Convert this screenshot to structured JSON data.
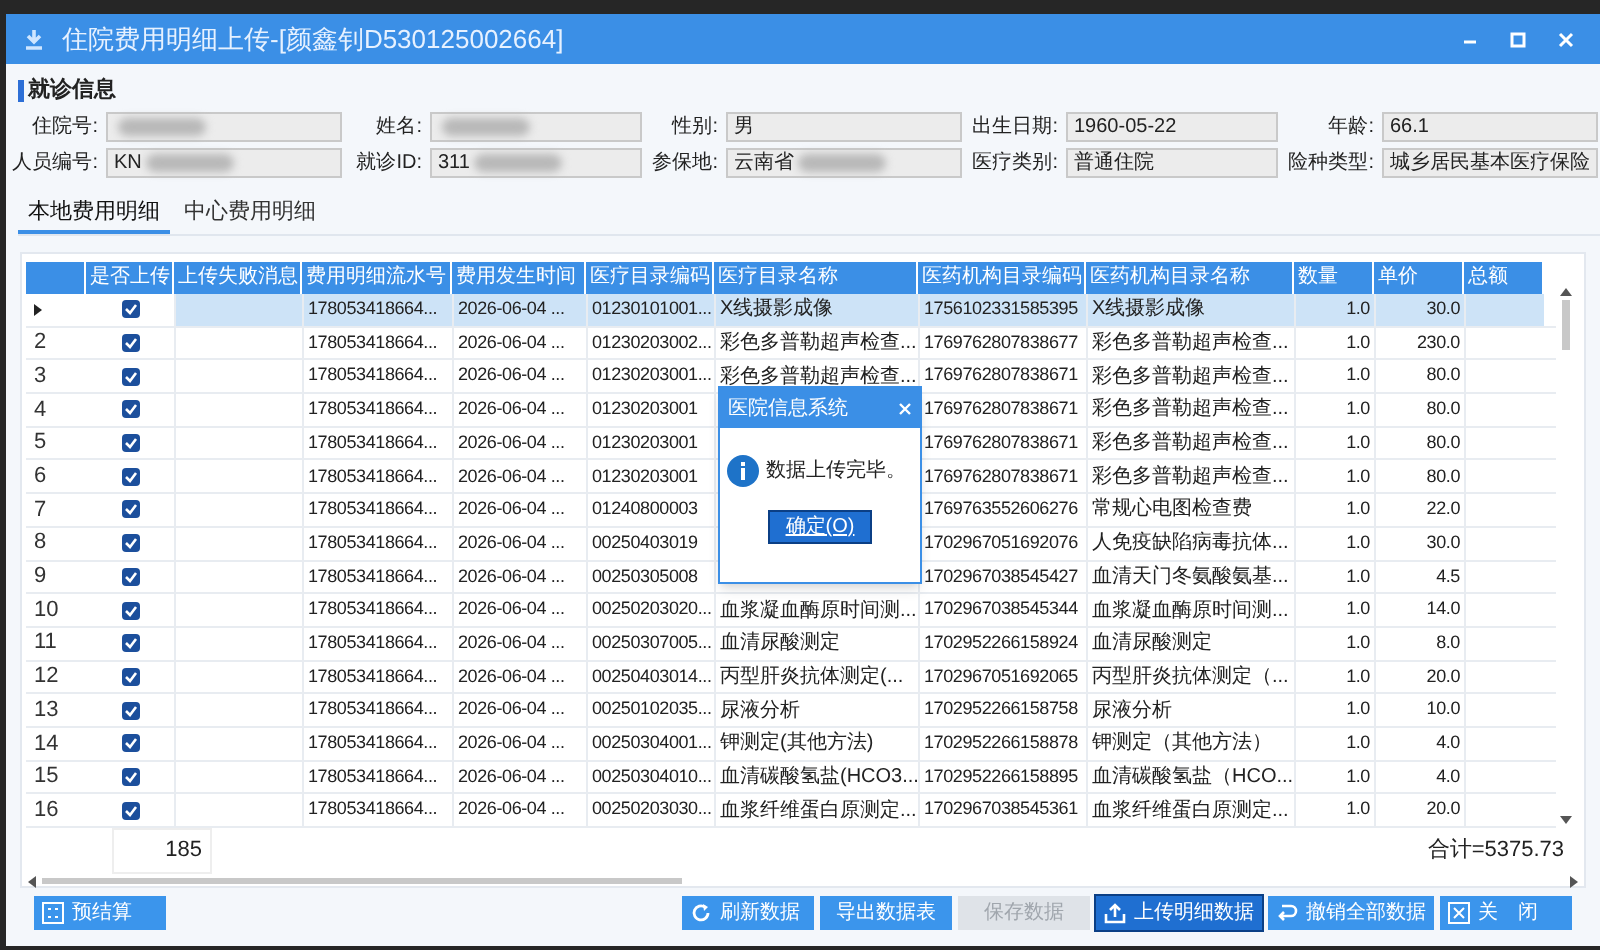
{
  "window": {
    "title": "住院费用明细上传-[颜鑫钊D530125002664]"
  },
  "section_title": "就诊信息",
  "fields": [
    {
      "label": "住院号:",
      "redacted": true
    },
    {
      "label": "姓名:",
      "redacted": true
    },
    {
      "label": "性别:",
      "value": "男"
    },
    {
      "label": "出生日期:",
      "value": "1960-05-22"
    },
    {
      "label": "年龄:",
      "value": "66.1"
    },
    {
      "label": "人员编号:",
      "value": "KN",
      "redacted": true
    },
    {
      "label": "就诊ID:",
      "value": "311",
      "redacted": true
    },
    {
      "label": "参保地:",
      "value": "云南省",
      "redacted": true
    },
    {
      "label": "医疗类别:",
      "value": "普通住院"
    },
    {
      "label": "险种类型:",
      "value": "城乡居民基本医疗保险"
    }
  ],
  "tabs": [
    {
      "label": "本地费用明细",
      "selected": true
    },
    {
      "label": "中心费用明细",
      "selected": false
    }
  ],
  "table": {
    "columns": [
      "是否上传",
      "上传失败消息",
      "费用明细流水号",
      "费用发生时间",
      "医疗目录编码",
      "医疗目录名称",
      "医药机构目录编码",
      "医药机构目录名称",
      "数量",
      "单价",
      "总额"
    ],
    "rows": [
      {
        "selected": true,
        "checked": true,
        "serial": "178053418664...",
        "time": "2026-06-04 ...",
        "code": "01230101001...",
        "name": "X线摄影成像",
        "org_code": "1756102331585395",
        "org_name": "X线摄影成像",
        "qty": "1.0",
        "price": "30.0"
      },
      {
        "row_number": "2",
        "selected": false,
        "checked": true,
        "serial": "178053418664...",
        "time": "2026-06-04 ...",
        "code": "01230203002...",
        "name": "彩色多普勒超声检查...",
        "org_code": "1769762807838677",
        "org_name": "彩色多普勒超声检查...",
        "qty": "1.0",
        "price": "230.0"
      },
      {
        "row_number": "3",
        "selected": false,
        "checked": true,
        "serial": "178053418664...",
        "time": "2026-06-04 ...",
        "code": "01230203001...",
        "name": "彩色多普勒超声检查...",
        "org_code": "1769762807838671",
        "org_name": "彩色多普勒超声检查...",
        "qty": "1.0",
        "price": "80.0"
      },
      {
        "row_number": "4",
        "selected": false,
        "checked": true,
        "serial": "178053418664...",
        "time": "2026-06-04 ...",
        "code": "01230203001",
        "org_code": "1769762807838671",
        "org_name": "彩色多普勒超声检查...",
        "qty": "1.0",
        "price": "80.0"
      },
      {
        "row_number": "5",
        "selected": false,
        "checked": true,
        "serial": "178053418664...",
        "time": "2026-06-04 ...",
        "code": "01230203001",
        "org_code": "1769762807838671",
        "org_name": "彩色多普勒超声检查...",
        "qty": "1.0",
        "price": "80.0"
      },
      {
        "row_number": "6",
        "selected": false,
        "checked": true,
        "serial": "178053418664...",
        "time": "2026-06-04 ...",
        "code": "01230203001",
        "org_code": "1769762807838671",
        "org_name": "彩色多普勒超声检查...",
        "qty": "1.0",
        "price": "80.0"
      },
      {
        "row_number": "7",
        "selected": false,
        "checked": true,
        "serial": "178053418664...",
        "time": "2026-06-04 ...",
        "code": "01240800003",
        "org_code": "1769763552606276",
        "org_name": "常规心电图检查费",
        "qty": "1.0",
        "price": "22.0"
      },
      {
        "row_number": "8",
        "selected": false,
        "checked": true,
        "serial": "178053418664...",
        "time": "2026-06-04 ...",
        "code": "00250403019",
        "org_code": "1702967051692076",
        "org_name": "人免疫缺陷病毒抗体...",
        "qty": "1.0",
        "price": "30.0"
      },
      {
        "row_number": "9",
        "selected": false,
        "checked": true,
        "serial": "178053418664...",
        "time": "2026-06-04 ...",
        "code": "00250305008",
        "org_code": "1702967038545427",
        "org_name": "血清天门冬氨酸氨基...",
        "qty": "1.0",
        "price": "4.5"
      },
      {
        "row_number": "10",
        "selected": false,
        "checked": true,
        "serial": "178053418664...",
        "time": "2026-06-04 ...",
        "code": "00250203020...",
        "name": "血浆凝血酶原时间测...",
        "org_code": "1702967038545344",
        "org_name": "血浆凝血酶原时间测...",
        "qty": "1.0",
        "price": "14.0"
      },
      {
        "row_number": "11",
        "selected": false,
        "checked": true,
        "serial": "178053418664...",
        "time": "2026-06-04 ...",
        "code": "00250307005...",
        "name": "血清尿酸测定",
        "org_code": "1702952266158924",
        "org_name": "血清尿酸测定",
        "qty": "1.0",
        "price": "8.0"
      },
      {
        "row_number": "12",
        "selected": false,
        "checked": true,
        "serial": "178053418664...",
        "time": "2026-06-04 ...",
        "code": "00250403014...",
        "name": "丙型肝炎抗体测定(...",
        "org_code": "1702967051692065",
        "org_name": "丙型肝炎抗体测定（...",
        "qty": "1.0",
        "price": "20.0"
      },
      {
        "row_number": "13",
        "selected": false,
        "checked": true,
        "serial": "178053418664...",
        "time": "2026-06-04 ...",
        "code": "00250102035...",
        "name": "尿液分析",
        "org_code": "1702952266158758",
        "org_name": "尿液分析",
        "qty": "1.0",
        "price": "10.0"
      },
      {
        "row_number": "14",
        "selected": false,
        "checked": true,
        "serial": "178053418664...",
        "time": "2026-06-04 ...",
        "code": "00250304001...",
        "name": "钾测定(其他方法)",
        "org_code": "1702952266158878",
        "org_name": "钾测定（其他方法）",
        "qty": "1.0",
        "price": "4.0"
      },
      {
        "row_number": "15",
        "selected": false,
        "checked": true,
        "serial": "178053418664...",
        "time": "2026-06-04 ...",
        "code": "00250304010...",
        "name": "血清碳酸氢盐(HCO3...",
        "org_code": "1702952266158895",
        "org_name": "血清碳酸氢盐（HCO...",
        "qty": "1.0",
        "price": "4.0"
      },
      {
        "row_number": "16",
        "selected": false,
        "checked": true,
        "serial": "178053418664...",
        "time": "2026-06-04 ...",
        "code": "00250203030...",
        "name": "血浆纤维蛋白原测定...",
        "org_code": "1702967038545361",
        "org_name": "血浆纤维蛋白原测定...",
        "qty": "1.0",
        "price": "20.0"
      }
    ],
    "count": "185",
    "total": "合计=5375.73"
  },
  "buttons": [
    {
      "kind": "calc",
      "label": "预结算",
      "disabled": false,
      "focused": false
    },
    {
      "kind": "refresh",
      "label": "刷新数据",
      "disabled": false,
      "focused": false
    },
    {
      "kind": "plain",
      "label": "导出数据表",
      "disabled": false,
      "focused": false
    },
    {
      "kind": "plain",
      "label": "保存数据",
      "disabled": true,
      "focused": false
    },
    {
      "kind": "upload",
      "label": "上传明细数据",
      "disabled": false,
      "focused": true
    },
    {
      "kind": "undo",
      "label": "撤销全部数据",
      "disabled": false,
      "focused": false
    },
    {
      "kind": "close",
      "label": "关　闭",
      "disabled": false,
      "focused": false
    }
  ],
  "dialog": {
    "title": "医院信息系统",
    "message": "数据上传完毕。",
    "button": "确定(O)"
  }
}
